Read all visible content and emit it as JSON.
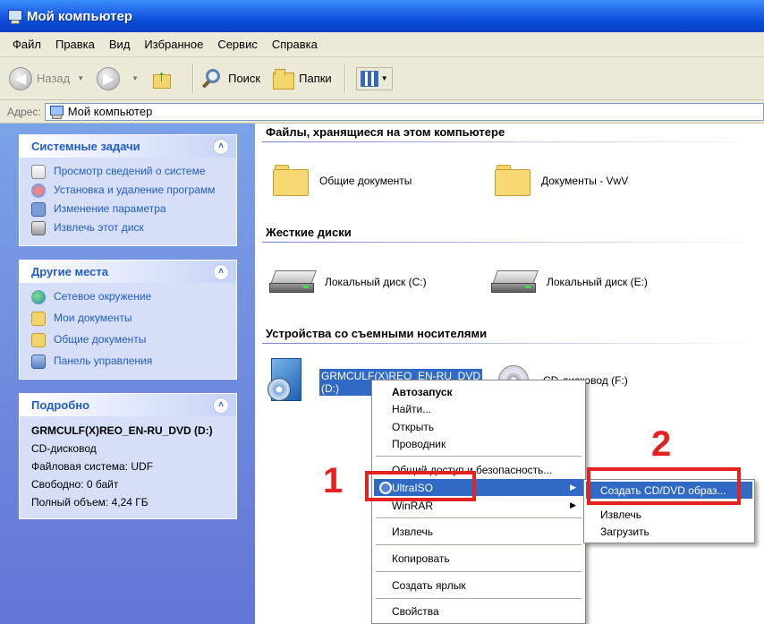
{
  "window": {
    "title": "Мой компьютер"
  },
  "menu": [
    "Файл",
    "Правка",
    "Вид",
    "Избранное",
    "Сервис",
    "Справка"
  ],
  "toolbar": {
    "back": "Назад",
    "search": "Поиск",
    "folders": "Папки"
  },
  "address": {
    "label": "Адрес:",
    "value": "Мой компьютер"
  },
  "left": {
    "system_tasks": {
      "title": "Системные задачи",
      "items": [
        "Просмотр сведений о системе",
        "Установка и удаление программ",
        "Изменение параметра",
        "Извлечь этот диск"
      ]
    },
    "other_places": {
      "title": "Другие места",
      "items": [
        "Сетевое окружение",
        "Мои документы",
        "Общие документы",
        "Панель управления"
      ]
    },
    "details": {
      "title": "Подробно",
      "name": "GRMCULF(X)REO_EN-RU_DVD (D:)",
      "type": "CD-дисковод",
      "fs": "Файловая система: UDF",
      "free": "Свободно: 0 байт",
      "total": "Полный объем: 4,24 ГБ"
    }
  },
  "content": {
    "files_header": "Файлы, хранящиеся на этом компьютере",
    "shared_docs": "Общие документы",
    "user_docs": "Документы - VwV",
    "hdd_header": "Жесткие диски",
    "drive_c": "Локальный диск (C:)",
    "drive_e": "Локальный диск (E:)",
    "removable_header": "Устройства со съемными носителями",
    "dvd_line1": "GRMCULF(X)REO_EN-RU_DVD",
    "dvd_line2": "(D:)",
    "cd_drive": "CD-дисковод (F:)"
  },
  "context_menu": {
    "autorun": "Автозапуск",
    "find": "Найти...",
    "open": "Открыть",
    "explore": "Проводник",
    "sharing": "Общий доступ и безопасность...",
    "ultraiso": "UltraISO",
    "winrar": "WinRAR",
    "eject": "Извлечь",
    "copy": "Копировать",
    "shortcut": "Создать ярлык",
    "properties": "Свойства"
  },
  "submenu": {
    "create_image": "Создать CD/DVD образ...",
    "eject": "Извлечь",
    "load": "Загрузить"
  },
  "annotations": {
    "step1": "1",
    "step2": "2"
  },
  "colors": {
    "accent": "#316ac5",
    "annotation": "#e52222",
    "link": "#215dc6"
  }
}
